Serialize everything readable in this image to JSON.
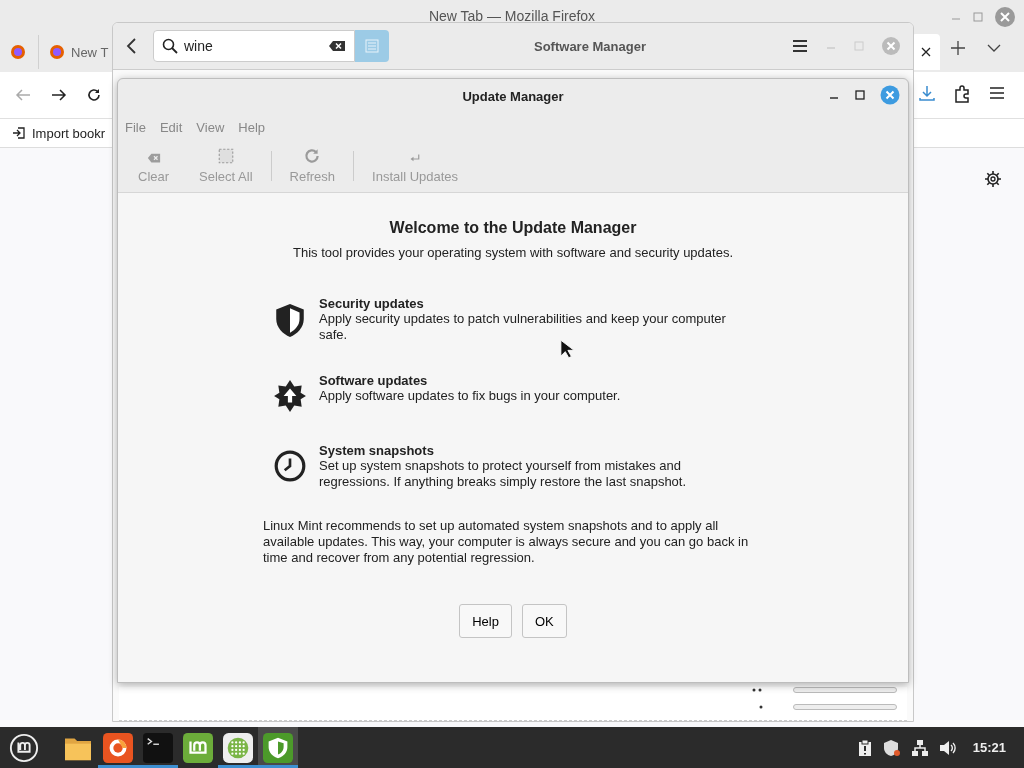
{
  "firefox": {
    "title": "New Tab — Mozilla Firefox",
    "tab": {
      "label": "New T"
    },
    "bookmark": "Import bookr"
  },
  "software_manager": {
    "title": "Software Manager",
    "search": {
      "value": "wine"
    }
  },
  "update_manager": {
    "title": "Update Manager",
    "menu": [
      "File",
      "Edit",
      "View",
      "Help"
    ],
    "toolbar": [
      {
        "kind": "clear",
        "label": "Clear",
        "disabled": true
      },
      {
        "kind": "select-all",
        "label": "Select All",
        "disabled": true
      },
      {
        "kind": "refresh",
        "label": "Refresh",
        "disabled": true
      },
      {
        "kind": "install",
        "label": "Install Updates",
        "disabled": true
      }
    ],
    "heading": "Welcome to the Update Manager",
    "intro": "This tool provides your operating system with software and security updates.",
    "features": [
      {
        "kind": "security",
        "title": "Security updates",
        "text": "Apply security updates to patch vulnerabilities and keep your computer safe."
      },
      {
        "kind": "software",
        "title": "Software updates",
        "text": "Apply software updates to fix bugs in your computer."
      },
      {
        "kind": "snapshots",
        "title": "System snapshots",
        "text": "Set up system snapshots to protect yourself from mistakes and regressions. If anything breaks simply restore the last snapshot."
      }
    ],
    "note": "Linux Mint recommends to set up automated system snapshots and to apply all available updates. This way, your computer is always secure and you can go back in time and recover from any potential regression.",
    "buttons": [
      "Help",
      "OK"
    ]
  },
  "taskbar": {
    "apps": [
      {
        "kind": "files",
        "running": false,
        "selected": false
      },
      {
        "kind": "firefox",
        "running": true,
        "selected": false
      },
      {
        "kind": "terminal",
        "running": true,
        "selected": false
      },
      {
        "kind": "mint",
        "running": false,
        "selected": false
      },
      {
        "kind": "software",
        "running": true,
        "selected": false
      },
      {
        "kind": "update",
        "running": true,
        "selected": true
      }
    ],
    "clock": "15:21"
  }
}
